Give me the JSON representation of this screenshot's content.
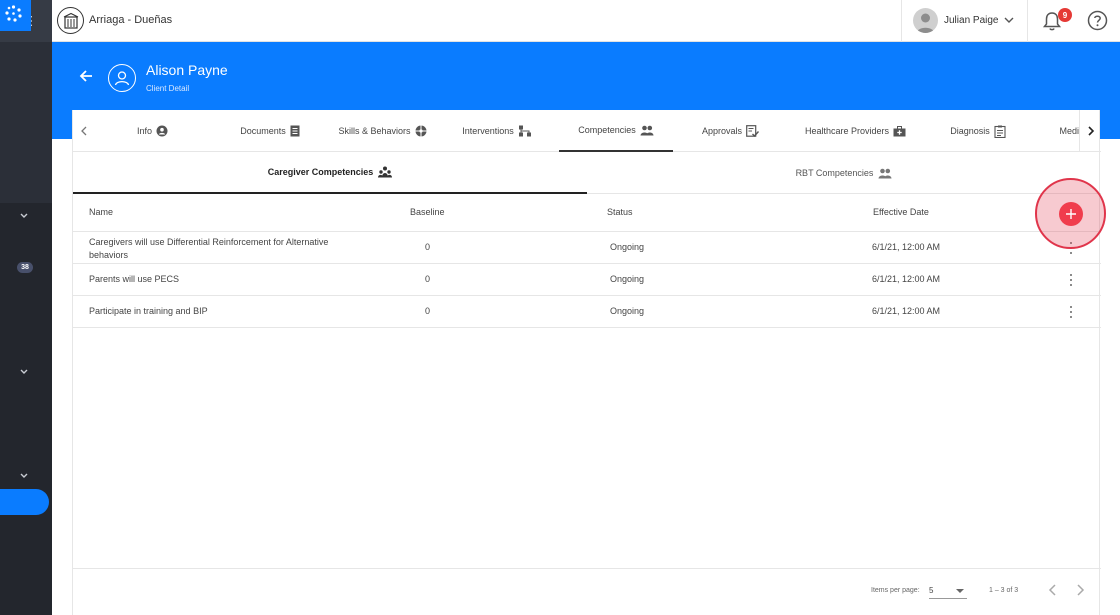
{
  "organization": {
    "name": "Arriaga - Dueñas"
  },
  "user": {
    "name": "Julian Paige"
  },
  "notifications": {
    "count": "9"
  },
  "sidebar": {
    "badge": "38"
  },
  "client": {
    "name": "Alison Payne",
    "subtitle": "Client Detail"
  },
  "tabs": [
    {
      "label": "Info",
      "icon": "user-circle-icon"
    },
    {
      "label": "Documents",
      "icon": "document-icon"
    },
    {
      "label": "Skills & Behaviors",
      "icon": "puzzle-icon"
    },
    {
      "label": "Interventions",
      "icon": "network-icon"
    },
    {
      "label": "Competencies",
      "icon": "people-icon",
      "active": true
    },
    {
      "label": "Approvals",
      "icon": "checklist-icon"
    },
    {
      "label": "Healthcare Providers",
      "icon": "medical-kit-icon"
    },
    {
      "label": "Diagnosis",
      "icon": "clipboard-icon"
    },
    {
      "label": "Medi",
      "icon": ""
    }
  ],
  "subtabs": [
    {
      "label": "Caregiver Competencies",
      "active": true
    },
    {
      "label": "RBT Competencies",
      "active": false
    }
  ],
  "table": {
    "columns": [
      "Name",
      "Baseline",
      "Status",
      "Effective Date"
    ],
    "rows": [
      {
        "name_line1": "Caregivers will use Differential Reinforcement for Alternative",
        "name_line2": "behaviors",
        "baseline": "0",
        "status": "Ongoing",
        "effective_date": "6/1/21, 12:00 AM"
      },
      {
        "name_line1": "Parents will use PECS",
        "name_line2": "",
        "baseline": "0",
        "status": "Ongoing",
        "effective_date": "6/1/21, 12:00 AM"
      },
      {
        "name_line1": "Participate in training and BIP",
        "name_line2": "",
        "baseline": "0",
        "status": "Ongoing",
        "effective_date": "6/1/21, 12:00 AM"
      }
    ]
  },
  "pagination": {
    "items_per_page_label": "Items per page:",
    "items_per_page": "5",
    "range": "1 – 3 of 3"
  },
  "colors": {
    "primary": "#0a7cff",
    "sidebar": "#2b2f38",
    "add_button": "#f03d4d",
    "notification_badge": "#e53935"
  }
}
